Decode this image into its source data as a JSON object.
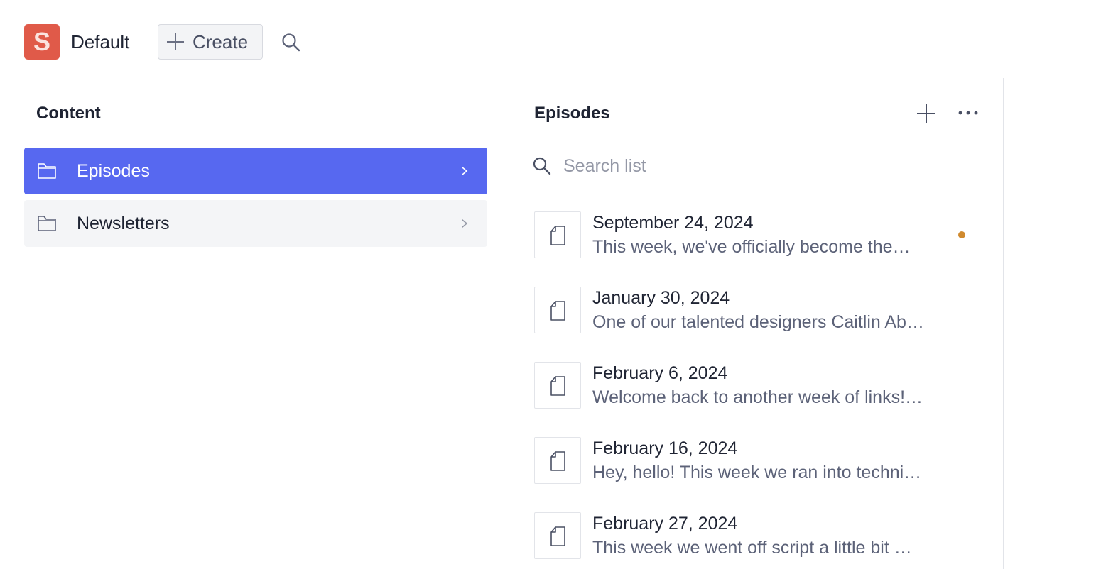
{
  "topbar": {
    "logo_letter": "S",
    "workspace_name": "Default",
    "create_label": "Create"
  },
  "content_pane": {
    "title": "Content",
    "items": [
      {
        "label": "Episodes",
        "icon": "folder-icon",
        "selected": true
      },
      {
        "label": "Newsletters",
        "icon": "folder-icon",
        "selected": false
      }
    ]
  },
  "episodes_pane": {
    "title": "Episodes",
    "search_placeholder": "Search list",
    "documents": [
      {
        "title": "September 24, 2024",
        "subtitle": "This week, we've officially become the…",
        "has_status_dot": true
      },
      {
        "title": "January 30, 2024",
        "subtitle": "One of our talented designers Caitlin Ab…",
        "has_status_dot": false
      },
      {
        "title": "February 6, 2024",
        "subtitle": "Welcome back to another week of links!…",
        "has_status_dot": false
      },
      {
        "title": "February 16, 2024",
        "subtitle": "Hey, hello! This week we ran into techni…",
        "has_status_dot": false
      },
      {
        "title": "February 27, 2024",
        "subtitle": "This week we went off script a little bit …",
        "has_status_dot": false
      }
    ]
  },
  "colors": {
    "logo_bg": "#e05a49",
    "selected_item_bg": "#5768f0",
    "status_dot": "#d08a2e"
  }
}
